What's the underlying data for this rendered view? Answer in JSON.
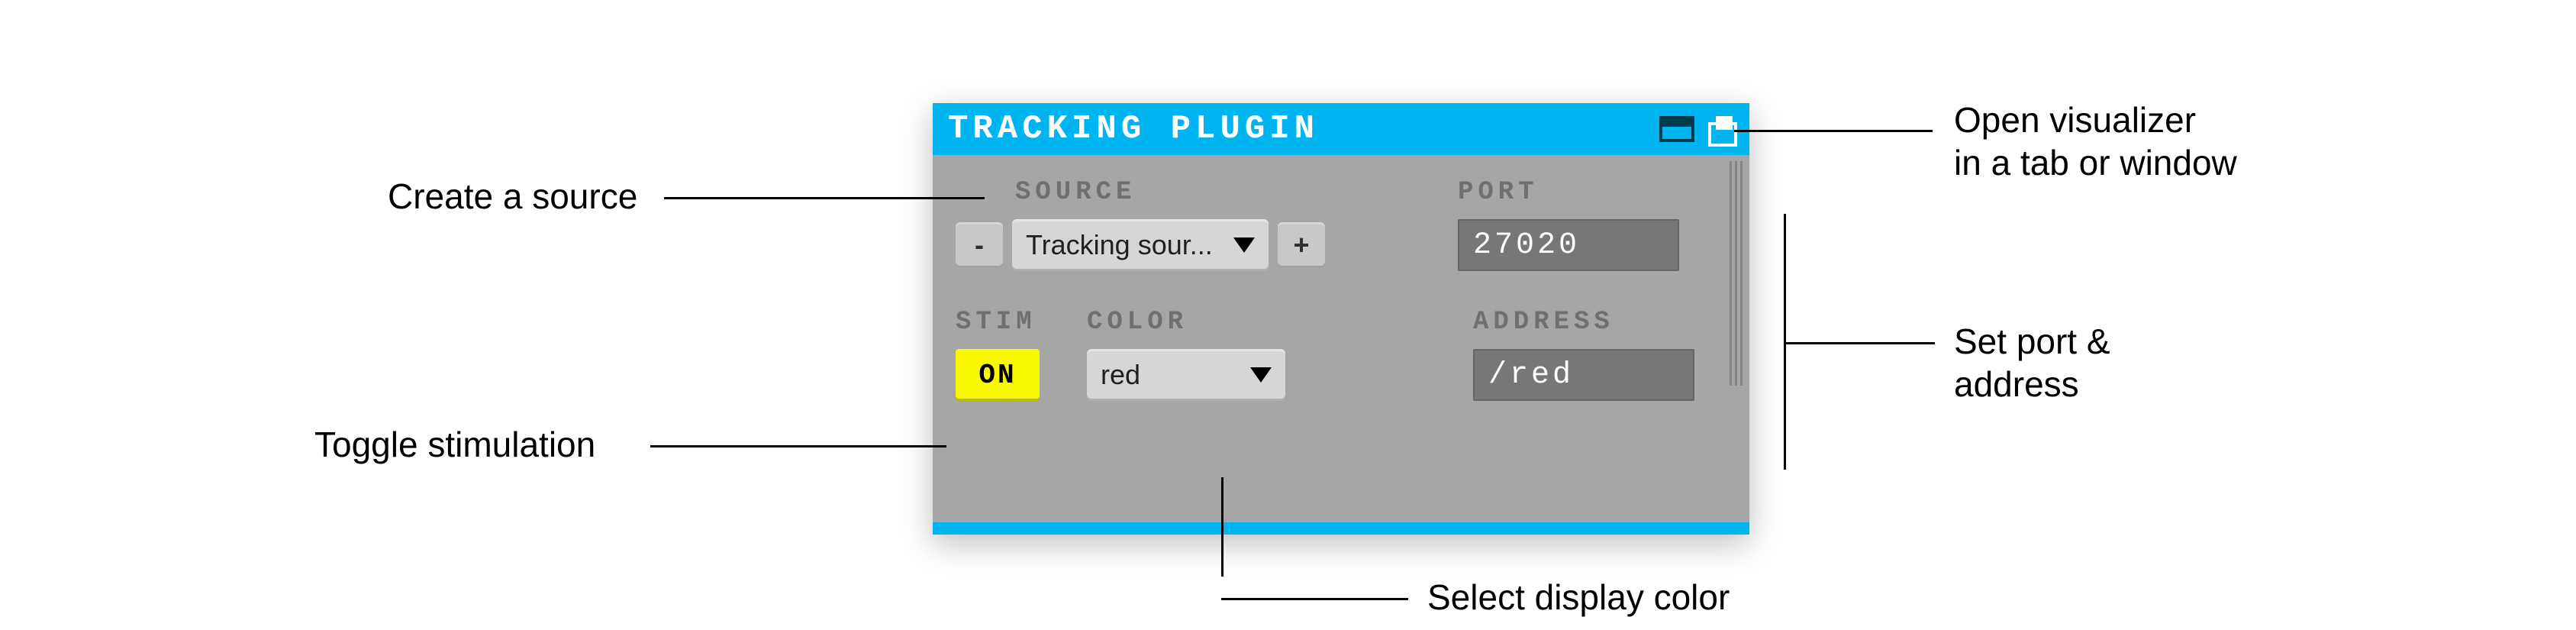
{
  "panel": {
    "title": "TRACKING  PLUGIN"
  },
  "row1": {
    "source_label": "SOURCE",
    "port_label": "PORT",
    "source_value": "Tracking sour...",
    "minus": "-",
    "plus": "+",
    "port_value": "27020"
  },
  "row2": {
    "stim_label": "STIM",
    "color_label": "COLOR",
    "address_label": "ADDRESS",
    "stim_value": "ON",
    "color_value": "red",
    "address_value": "/red"
  },
  "annotations": {
    "create_source": "Create a source",
    "toggle_stim": "Toggle stimulation",
    "open_vis_l1": "Open visualizer",
    "open_vis_l2": "in a tab or window",
    "set_port_l1": "Set port &",
    "set_port_l2": "address",
    "select_color": "Select display color"
  }
}
